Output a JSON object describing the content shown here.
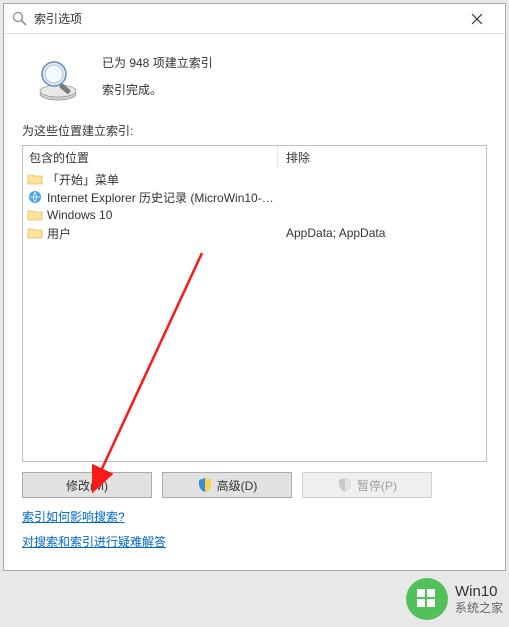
{
  "titlebar": {
    "title": "索引选项"
  },
  "status": {
    "line1": "已为 948 项建立索引",
    "line2": "索引完成。"
  },
  "list_label": "为这些位置建立索引:",
  "columns": {
    "included": "包含的位置",
    "excluded": "排除"
  },
  "rows": [
    {
      "icon": "folder",
      "label": "「开始」菜单",
      "excluded": ""
    },
    {
      "icon": "ie",
      "label": "Internet Explorer 历史记录 (MicroWin10-…",
      "excluded": ""
    },
    {
      "icon": "folder",
      "label": "Windows 10",
      "excluded": ""
    },
    {
      "icon": "folder",
      "label": "用户",
      "excluded": "AppData; AppData"
    }
  ],
  "buttons": {
    "modify": "修改(M)",
    "advanced": "高级(D)",
    "pause": "暂停(P)"
  },
  "links": {
    "link1": "索引如何影响搜索?",
    "link2": "对搜索和索引进行疑难解答"
  },
  "watermark": {
    "line1": "Win10",
    "line2": "系统之家"
  }
}
